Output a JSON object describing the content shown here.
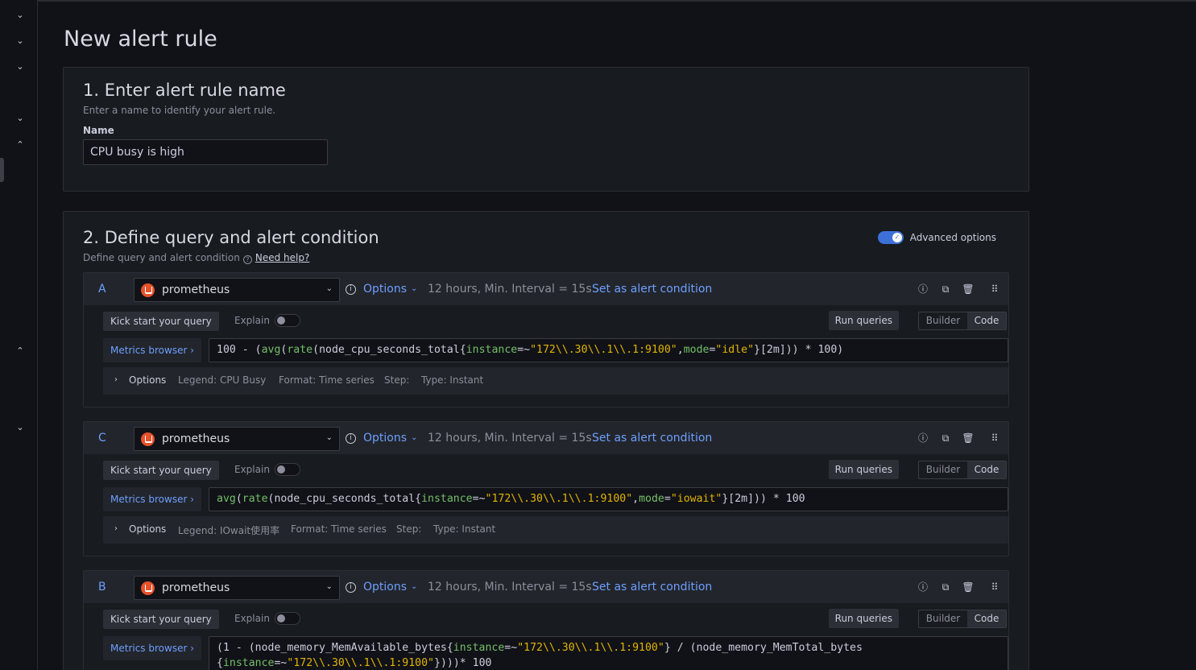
{
  "page": {
    "title": "New alert rule"
  },
  "section1": {
    "title": "1. Enter alert rule name",
    "description": "Enter a name to identify your alert rule.",
    "name_label": "Name",
    "name_value": "CPU busy is high"
  },
  "section2": {
    "title": "2. Define query and alert condition",
    "description": "Define query and alert condition",
    "help_link": "Need help?",
    "advanced_label": "Advanced options",
    "advanced_enabled": true
  },
  "common": {
    "datasource": "prometheus",
    "options_label": "Options",
    "interval": "12 hours, Min. Interval = 15s",
    "set_condition": "Set as alert condition",
    "kick_start": "Kick start your query",
    "explain": "Explain",
    "run_queries": "Run queries",
    "builder": "Builder",
    "code": "Code",
    "metrics_browser": "Metrics browser ›"
  },
  "queries": [
    {
      "letter": "A",
      "code_parts": [
        "100 - (",
        "avg",
        "(",
        "rate",
        "(node_cpu_seconds_total{",
        "instance",
        "=~",
        "\"172\\\\.30\\\\.1\\\\.1:9100\"",
        ",",
        "mode",
        "=",
        "\"idle\"",
        "}[2m])) * 100)"
      ],
      "options_title": "Options",
      "legend": "Legend: CPU Busy",
      "format": "Format: Time series",
      "step": "Step:",
      "type": "Type: Instant"
    },
    {
      "letter": "C",
      "code_parts": [
        "avg",
        "(",
        "rate",
        "(node_cpu_seconds_total{",
        "instance",
        "=~",
        "\"172\\\\.30\\\\.1\\\\.1:9100\"",
        ",",
        "mode",
        "=",
        "\"iowait\"",
        "}[2m])) * 100"
      ],
      "options_title": "Options",
      "legend": "Legend: IOwait使用率",
      "format": "Format: Time series",
      "step": "Step:",
      "type": "Type: Instant"
    },
    {
      "letter": "B",
      "code_line1": [
        "(1 - (node_memory_MemAvailable_bytes{",
        "instance",
        "=~",
        "\"172\\\\.30\\\\.1\\\\.1:9100\"",
        "} / (node_memory_MemTotal_bytes"
      ],
      "code_line2": [
        "{",
        "instance",
        "=~",
        "\"172\\\\.30\\\\.1\\\\.1:9100\"",
        "})))* 100"
      ]
    }
  ]
}
